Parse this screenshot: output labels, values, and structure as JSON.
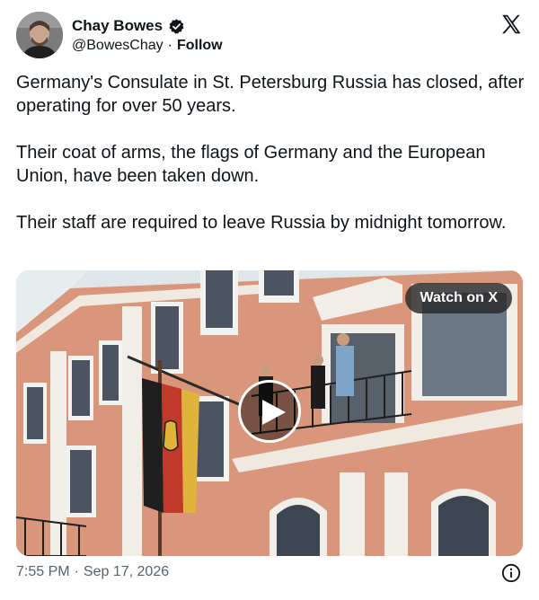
{
  "author": {
    "name": "Chay Bowes",
    "handle": "@BowesChay",
    "separator": "·",
    "follow_label": "Follow"
  },
  "icons": {
    "verified": "verified-badge-icon",
    "logo": "x-logo-icon",
    "play": "play-icon",
    "info": "info-icon"
  },
  "tweet": {
    "paragraphs": [
      "Germany's Consulate in St. Petersburg Russia has closed, after operating for over 50 years.",
      "Their coat of arms, the flags of Germany and the European Union, have been taken down.",
      "Their staff are required to leave Russia by midnight tomorrow."
    ]
  },
  "media": {
    "watch_label": "Watch on X"
  },
  "footer": {
    "time": "7:55 PM",
    "separator": "·",
    "date": "Sep 17, 2026"
  },
  "colors": {
    "text": "#0f1419",
    "secondary_text": "#536471",
    "verified_badge": "#0f1419",
    "building_facade": "#d9967a",
    "window_trim": "#f2f2f0"
  }
}
